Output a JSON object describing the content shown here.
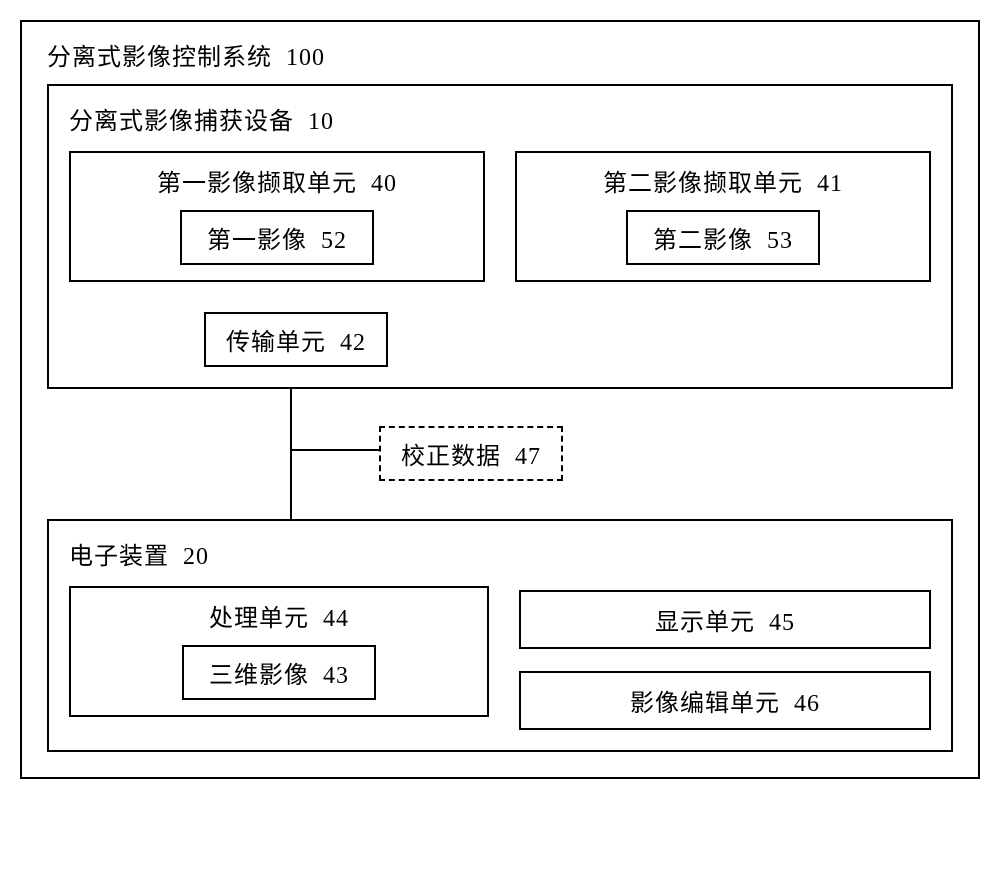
{
  "system": {
    "title": "分离式影像控制系统",
    "id": "100"
  },
  "capture_device": {
    "title": "分离式影像捕获设备",
    "id": "10",
    "unit1": {
      "title": "第一影像撷取单元",
      "id": "40",
      "image_label": "第一影像",
      "image_id": "52"
    },
    "unit2": {
      "title": "第二影像撷取单元",
      "id": "41",
      "image_label": "第二影像",
      "image_id": "53"
    },
    "transmission": {
      "label": "传输单元",
      "id": "42"
    }
  },
  "correction": {
    "label": "校正数据",
    "id": "47"
  },
  "electronic_device": {
    "title": "电子装置",
    "id": "20",
    "processing": {
      "title": "处理单元",
      "id": "44",
      "image_label": "三维影像",
      "image_id": "43"
    },
    "display": {
      "label": "显示单元",
      "id": "45"
    },
    "editing": {
      "label": "影像编辑单元",
      "id": "46"
    }
  }
}
